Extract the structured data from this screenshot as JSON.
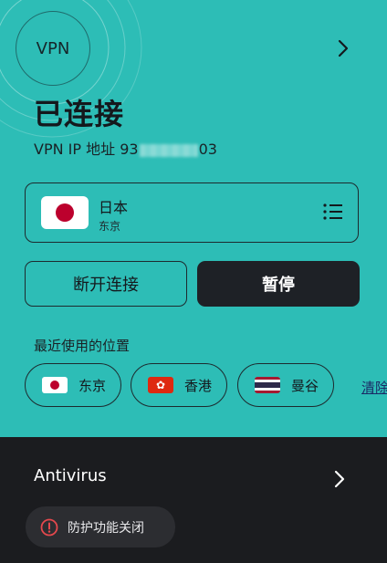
{
  "vpn": {
    "badge": "VPN",
    "status_title": "已连接",
    "ip_prefix": "VPN IP 地址 93",
    "ip_suffix": "03",
    "accent_color": "#2dbdb6"
  },
  "location": {
    "country": "日本",
    "city": "东京",
    "flag": "japan-flag"
  },
  "buttons": {
    "disconnect": "断开连接",
    "pause": "暂停"
  },
  "recent": {
    "title": "最近使用的位置",
    "items": [
      {
        "label": "东京",
        "flag": "japan-flag"
      },
      {
        "label": "香港",
        "flag": "hong-kong-flag"
      },
      {
        "label": "曼谷",
        "flag": "thailand-flag"
      }
    ],
    "clear_label": "清除"
  },
  "antivirus": {
    "title": "Antivirus",
    "status": "防护功能关闭",
    "status_color": "#e5484d"
  }
}
